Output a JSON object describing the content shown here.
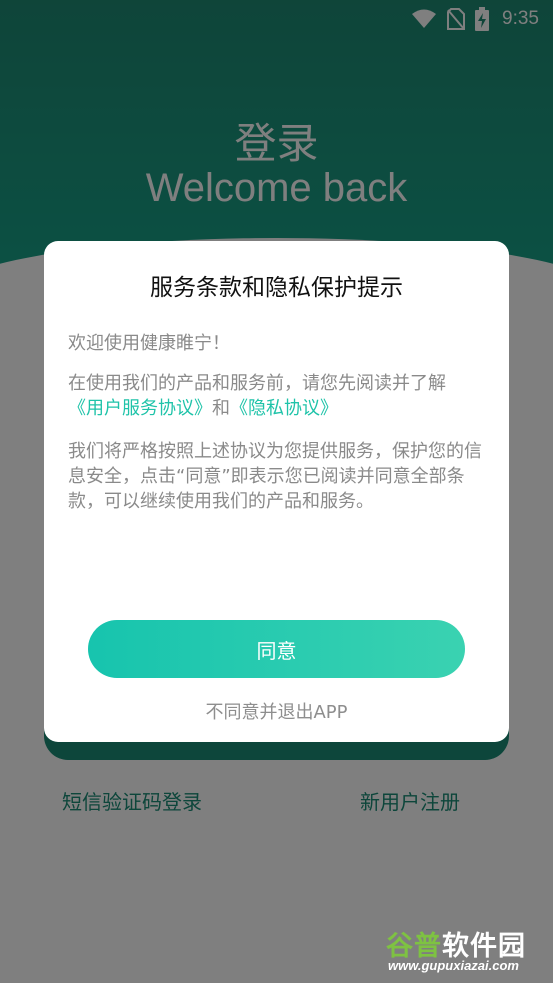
{
  "status_bar": {
    "time": "9:35",
    "icons": [
      "wifi-icon",
      "no-sim-icon",
      "battery-charging-icon"
    ]
  },
  "login": {
    "title_cn": "登录",
    "title_en": "Welcome back",
    "link_sms": "短信验证码登录",
    "link_register": "新用户注册"
  },
  "dialog": {
    "title": "服务条款和隐私保护提示",
    "greeting": "欢迎使用健康睢宁！",
    "intro": "在使用我们的产品和服务前，请您先阅读并了解",
    "link_user_agreement": "《用户服务协议》",
    "and": "和",
    "link_privacy": "《隐私协议》",
    "body": "我们将严格按照上述协议为您提供服务，保护您的信息安全，点击“同意”即表示您已阅读并同意全部条款，可以继续使用我们的产品和服务。",
    "agree_label": "同意",
    "disagree_label": "不同意并退出APP"
  },
  "watermark": {
    "name_part1": "谷普",
    "name_part2": "软件园",
    "url": "www.gupuxiazai.com"
  },
  "colors": {
    "brand": "#1b8c76",
    "accent": "#1fc3a9",
    "button_start": "#17c4ae",
    "button_end": "#3ad2b1"
  }
}
